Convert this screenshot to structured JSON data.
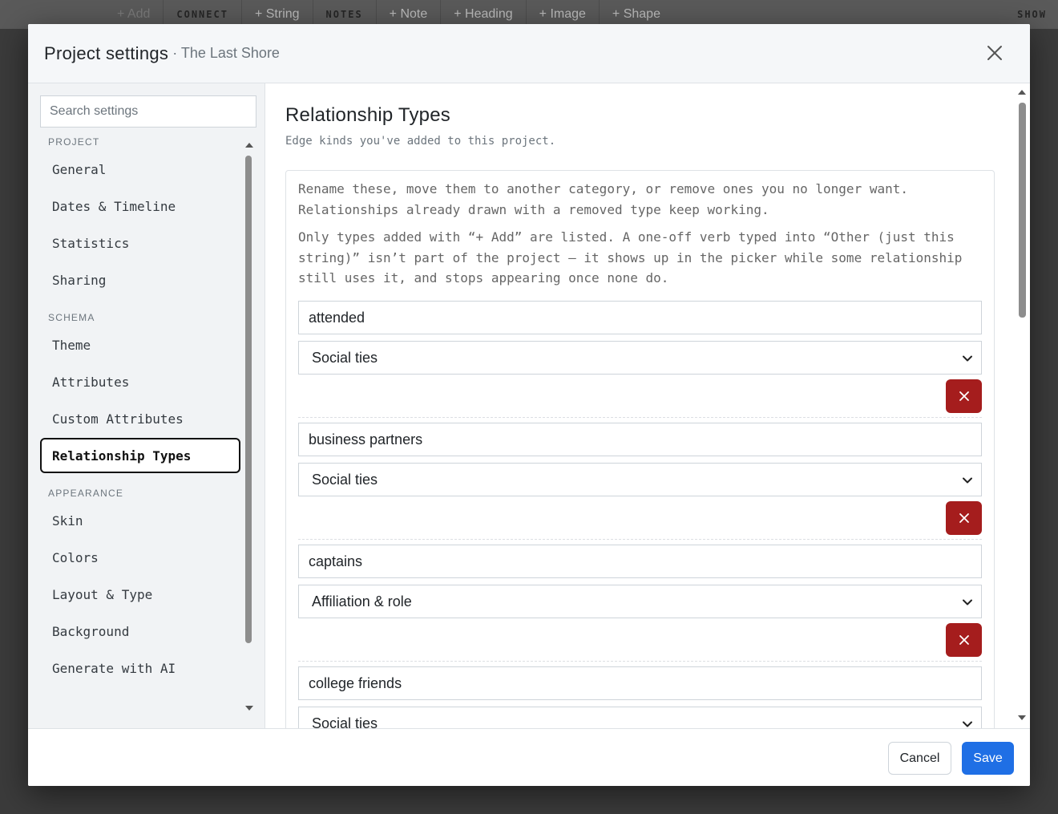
{
  "background": {
    "toolbar": {
      "add_label": "+ Add",
      "connect_label": "CONNECT",
      "string_label": "+ String",
      "notes_label": "NOTES",
      "note_label": "+ Note",
      "heading_label": "+ Heading",
      "image_label": "+ Image",
      "shape_label": "+ Shape",
      "show_label": "SHOW"
    }
  },
  "modal": {
    "title": "Project settings",
    "subtitle": "· The Last Shore",
    "close_icon": "close-icon"
  },
  "sidebar": {
    "search_placeholder": "Search settings",
    "sections": [
      {
        "label": "PROJECT",
        "items": [
          {
            "label": "General",
            "active": false
          },
          {
            "label": "Dates & Timeline",
            "active": false
          },
          {
            "label": "Statistics",
            "active": false
          },
          {
            "label": "Sharing",
            "active": false
          }
        ]
      },
      {
        "label": "SCHEMA",
        "items": [
          {
            "label": "Theme",
            "active": false
          },
          {
            "label": "Attributes",
            "active": false
          },
          {
            "label": "Custom Attributes",
            "active": false
          },
          {
            "label": "Relationship Types",
            "active": true
          }
        ]
      },
      {
        "label": "APPEARANCE",
        "items": [
          {
            "label": "Skin",
            "active": false
          },
          {
            "label": "Colors",
            "active": false
          },
          {
            "label": "Layout & Type",
            "active": false
          },
          {
            "label": "Background",
            "active": false
          },
          {
            "label": "Generate with AI",
            "active": false
          }
        ]
      }
    ]
  },
  "content": {
    "title": "Relationship Types",
    "subtitle": "Edge kinds you've added to this project.",
    "help_1": "Rename these, move them to another category, or remove ones you no longer want. Relationships already drawn with a removed type keep working.",
    "help_2": "Only types added with “+ Add” are listed. A one-off verb typed into “Other (just this string)” isn’t part of the project — it shows up in the picker while some relationship still uses it, and stops appearing once none do.",
    "relationship_types": [
      {
        "name": "attended",
        "category": "Social ties"
      },
      {
        "name": "business partners",
        "category": "Social ties"
      },
      {
        "name": "captains",
        "category": "Affiliation & role"
      },
      {
        "name": "college friends",
        "category": "Social ties"
      }
    ]
  },
  "footer": {
    "cancel_label": "Cancel",
    "save_label": "Save"
  },
  "colors": {
    "accent": "#1f6fe5",
    "danger": "#a51d1d",
    "active_border": "#111111"
  }
}
